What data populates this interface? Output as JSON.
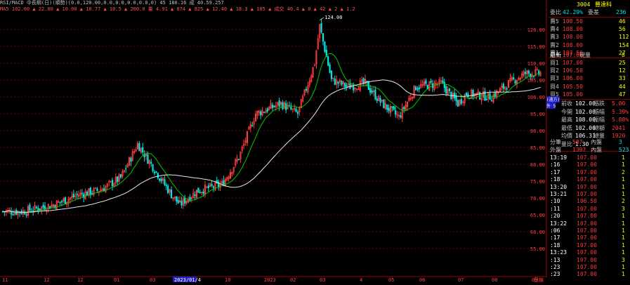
{
  "header": {
    "line1": "RSI/MACD 中長期(日)(順勢)(0.0,120.00,0.0,0.0,0.0,0.0,0) 45 180.16 成 40.59.257",
    "line2": "MA5 102.00 ▲ 22.00 ▲ 10.00 ▲ 10.77 ▲ 10.5 ▲ 200.0 量 4.91 ▲ 874 ▲ 825 ▲ 12.40 ▲ 18.3 ▲ 105 ▲ 成交 40.4 ▲ 0 ▲ 42 ▲ 2 ▲ 1.2"
  },
  "high_marker": "124.00",
  "price_axis": [
    "120.00",
    "115.00",
    "110.00",
    "105.00",
    "100.00",
    "95.00",
    "90.00",
    "85.00",
    "80.00",
    "75.00",
    "70.00",
    "65.00",
    "60.00",
    "55.00"
  ],
  "x_axis": [
    "11",
    "12",
    "12",
    "01",
    "03",
    "04",
    "10",
    "2023",
    "02",
    "03",
    "4",
    "05",
    "06",
    "07",
    "08",
    "09"
  ],
  "x_axis_highlight": "2023/01/4",
  "x_axis_end": "日線",
  "quote": {
    "code": "3004",
    "name": "豐達科",
    "title_row": {
      "label": "委比",
      "value": "42.29%",
      "label2": "委差",
      "value2": "236"
    },
    "asks": [
      {
        "label": "賣5",
        "price": "108.50",
        "vol": "46"
      },
      {
        "label": "賣4",
        "price": "108.00",
        "vol": "56"
      },
      {
        "label": "賣3",
        "price": "108.00",
        "vol": "112"
      },
      {
        "label": "賣2",
        "price": "108.00",
        "vol": "154"
      },
      {
        "label": "賣1",
        "price": "107.50",
        "vol": "27"
      }
    ],
    "last": {
      "label": "最新",
      "price": "107.00",
      "label2": "現量",
      "vol": "8"
    },
    "bids": [
      {
        "label": "買1",
        "price": "107.00",
        "vol": "25"
      },
      {
        "label": "買2",
        "price": "106.50",
        "vol": "12"
      },
      {
        "label": "買3",
        "price": "106.00",
        "vol": "33"
      },
      {
        "label": "買4",
        "price": "105.50",
        "vol": "44"
      },
      {
        "label": "買5",
        "price": "105.00",
        "vol": "47"
      }
    ],
    "stats": [
      {
        "l": "前收",
        "v": "102.00",
        "l2": "漲跌",
        "v2": "5.00"
      },
      {
        "l": "今開",
        "v": "102.00",
        "l2": "漲幅",
        "v2": "5.39%"
      },
      {
        "l": "最高",
        "v": "108.00",
        "l2": "振幅",
        "v2": "5.88%"
      },
      {
        "l": "最低",
        "v": "102.00",
        "l2": "總額",
        "v2": "2041"
      },
      {
        "l": "均價",
        "v": "106.31",
        "l2": "總量",
        "v2": "1920"
      },
      {
        "l": "量比",
        "v": "1.30",
        "l2": "",
        "v2": ""
      }
    ],
    "side_tags": [
      "(遠方)",
      "外 5"
    ],
    "io": [
      {
        "l": "分筆",
        "v": "587",
        "l2": "內盤",
        "v2": "3"
      },
      {
        "l": "外盤",
        "v": "1397",
        "l2": "內盤",
        "v2": "523"
      }
    ],
    "ticks": [
      {
        "t": "13:19",
        "p": "107.00",
        "v": "1"
      },
      {
        "t": ":16",
        "p": "107.00",
        "v": "1"
      },
      {
        "t": ":17",
        "p": "107.00",
        "v": "2"
      },
      {
        "t": ":18",
        "p": "107.00",
        "v": "1"
      },
      {
        "t": "13:20",
        "p": "107.00",
        "v": "1"
      },
      {
        "t": "13:21",
        "p": "107.00",
        "v": "1"
      },
      {
        "t": ":10",
        "p": "106.50",
        "v": "2"
      },
      {
        "t": ":11",
        "p": "107.00",
        "v": "3"
      },
      {
        "t": ":20",
        "p": "107.00",
        "v": "1"
      },
      {
        "t": "13:22",
        "p": "107.00",
        "v": "1"
      },
      {
        "t": ":06",
        "p": "107.00",
        "v": "1"
      },
      {
        "t": ":17",
        "p": "107.00",
        "v": "1"
      },
      {
        "t": ":18",
        "p": "107.00",
        "v": "1"
      },
      {
        "t": "13:23",
        "p": "107.00",
        "v": "1"
      },
      {
        "t": ":13",
        "p": "107.00",
        "v": "3"
      },
      {
        "t": ":23",
        "p": "107.00",
        "v": "1"
      },
      {
        "t": ":23",
        "p": "107.00",
        "v": "1"
      }
    ]
  },
  "colors": {
    "up": "#ff3c3c",
    "down": "#00e6e6",
    "ma_short": "#00c800",
    "ma_long": "#e8e8e8",
    "grid": "#6e0000",
    "label": "#ffff00"
  }
}
